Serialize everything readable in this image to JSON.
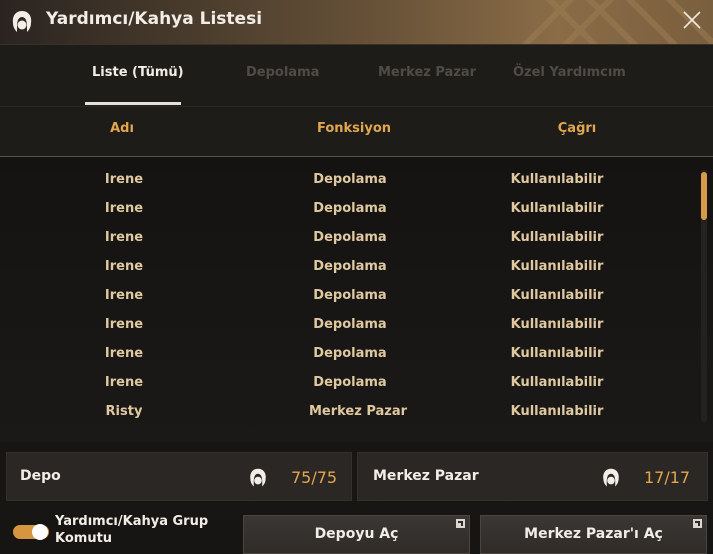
{
  "window": {
    "title": "Yardımcı/Kahya Listesi"
  },
  "tabs": [
    {
      "label": "Liste (Tümü)",
      "active": true
    },
    {
      "label": "Depolama",
      "active": false
    },
    {
      "label": "Merkez Pazar",
      "active": false
    },
    {
      "label": "Özel Yardımcım",
      "active": false
    }
  ],
  "columns": {
    "name": "Adı",
    "function": "Fonksiyon",
    "call": "Çağrı"
  },
  "rows": [
    {
      "name": "Irene",
      "function": "Depolama",
      "call": "Kullanılabilir"
    },
    {
      "name": "Irene",
      "function": "Depolama",
      "call": "Kullanılabilir"
    },
    {
      "name": "Irene",
      "function": "Depolama",
      "call": "Kullanılabilir"
    },
    {
      "name": "Irene",
      "function": "Depolama",
      "call": "Kullanılabilir"
    },
    {
      "name": "Irene",
      "function": "Depolama",
      "call": "Kullanılabilir"
    },
    {
      "name": "Irene",
      "function": "Depolama",
      "call": "Kullanılabilir"
    },
    {
      "name": "Irene",
      "function": "Depolama",
      "call": "Kullanılabilir"
    },
    {
      "name": "Irene",
      "function": "Depolama",
      "call": "Kullanılabilir"
    },
    {
      "name": "Risty",
      "function": "Merkez Pazar",
      "call": "Kullanılabilir"
    }
  ],
  "summary": {
    "depo": {
      "label": "Depo",
      "used": "75",
      "total": "75"
    },
    "market": {
      "label": "Merkez Pazar",
      "used": "17",
      "total": "17"
    }
  },
  "footer": {
    "group_command_label": "Yardımcı/Kahya Grup Komutu",
    "group_command_enabled": true,
    "open_storage_button": "Depoyu Aç",
    "open_market_button": "Merkez Pazar'ı Aç"
  },
  "colors": {
    "accent": "#e2a64f",
    "row_text": "#e0c9a0",
    "toggle": "#d6953f"
  },
  "icons": {
    "title": "maid-icon",
    "close": "close-icon",
    "summary": "maid-icon",
    "external": "external-window-icon"
  }
}
